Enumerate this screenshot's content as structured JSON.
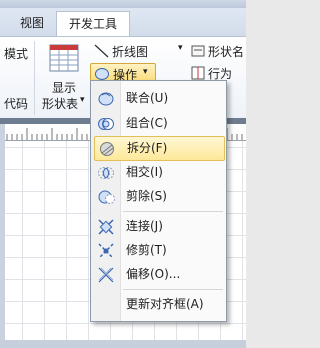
{
  "tabs": [
    {
      "label": "视图"
    },
    {
      "label": "开发工具"
    }
  ],
  "ribbon": {
    "left_partial_1": "模式",
    "left_partial_2": "代码",
    "show_shape_label_1": "显示",
    "show_shape_label_2": "形状表",
    "show_shape_dropdown": "▾",
    "connector_label": "折线图",
    "operations_label": "操作",
    "operations_dropdown": "▾",
    "shape_name_label": "形状名",
    "behavior_label": "行为",
    "group_dropdown": "▾"
  },
  "menu": {
    "items": [
      {
        "label": "联合(U)",
        "icon": "union-icon"
      },
      {
        "label": "组合(C)",
        "icon": "combine-icon"
      },
      {
        "label": "拆分(F)",
        "icon": "fragment-icon",
        "highlighted": true
      },
      {
        "label": "相交(I)",
        "icon": "intersect-icon"
      },
      {
        "label": "剪除(S)",
        "icon": "subtract-icon"
      },
      {
        "label": "连接(J)",
        "icon": "join-icon"
      },
      {
        "label": "修剪(T)",
        "icon": "trim-icon"
      },
      {
        "label": "偏移(O)...",
        "icon": "offset-icon"
      },
      {
        "label": "更新对齐框(A)",
        "icon": ""
      }
    ]
  },
  "colors": {
    "highlight": "#fde89a",
    "tab_active_bg": "#ffffff",
    "ribbon_bg": "#eef2f8"
  }
}
